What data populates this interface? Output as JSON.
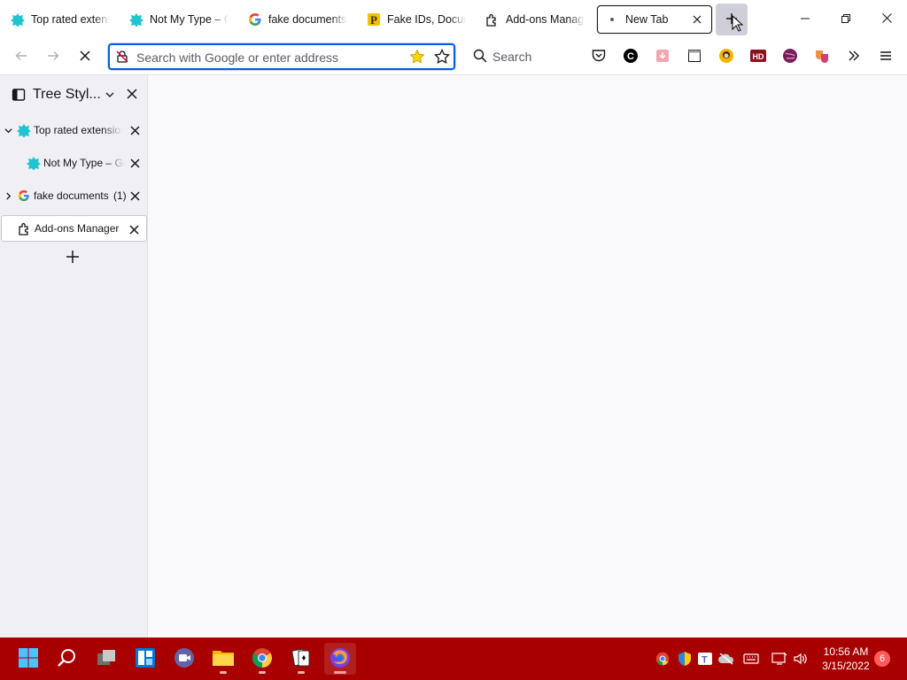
{
  "window": {
    "tabs": [
      {
        "title": "Top rated extensions",
        "icon": "puzzle-star-icon",
        "active": false
      },
      {
        "title": "Not My Type – Get",
        "icon": "puzzle-star-icon",
        "active": false
      },
      {
        "title": "fake documents",
        "icon": "google-g-icon",
        "active": false
      },
      {
        "title": "Fake IDs, Documents",
        "icon": "p-badge-icon",
        "active": false
      },
      {
        "title": "Add-ons Manager",
        "icon": "puzzle-icon",
        "active": false
      },
      {
        "title": "New Tab",
        "icon": "loading-dot-icon",
        "active": true
      }
    ]
  },
  "navbar": {
    "url_placeholder": "Search with Google or enter address",
    "search_label": "Search"
  },
  "sidebar": {
    "title": "Tree Styl...",
    "tree": [
      {
        "title": "Top rated extensions",
        "level": 0,
        "expanded": true
      },
      {
        "title": "Not My Type – Get",
        "level": 1
      },
      {
        "title": "fake documents",
        "level": 0,
        "expanded": false,
        "count": "(1)"
      },
      {
        "title": "Add-ons Manager",
        "level": 0,
        "active": true
      }
    ]
  },
  "taskbar": {
    "time": "10:56 AM",
    "date": "3/15/2022",
    "notifications": "6"
  },
  "colors": {
    "accent": "#0061e0",
    "taskbar": "#a80000",
    "sidebar_bg": "#f0f0f4",
    "content_bg": "#f9f9fb"
  }
}
